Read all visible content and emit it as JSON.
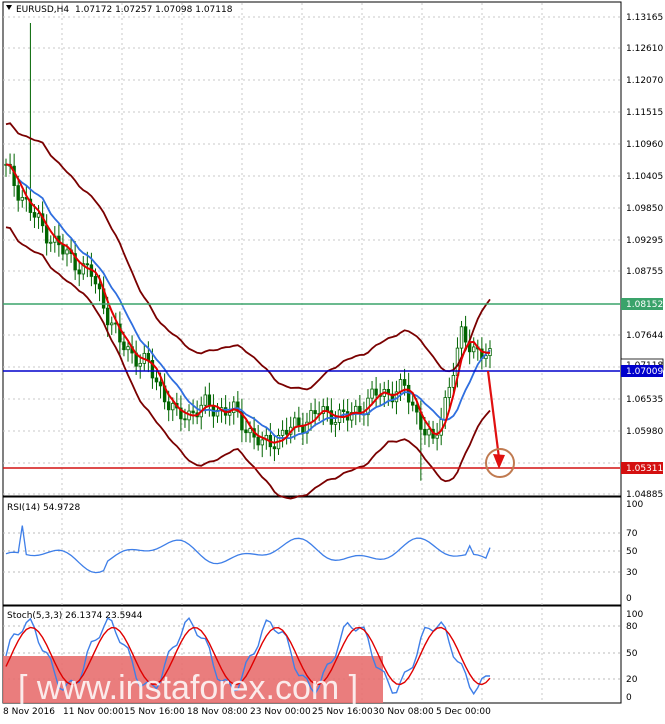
{
  "header": {
    "symbol": "EURUSD,H4",
    "ohlc": "1.07172 1.07257 1.07098 1.07118"
  },
  "colors": {
    "background": "#ffffff",
    "grid": "#c8c8c8",
    "candle": "#006400",
    "bollinger": "#7a0000",
    "ma_fast": "#e00000",
    "ma_slow": "#2f6fe0",
    "resistance_line": "#3aa36a",
    "support_line": "#d41010",
    "pivot_line": "#0000cc",
    "rsi_line": "#3f7fe8",
    "stoch_main": "#3f7fe8",
    "stoch_signal": "#e00000",
    "watermark_bg": "#e86f6f",
    "arrow": "#e01010",
    "target_circle": "#c07a50"
  },
  "price_axis": {
    "ticks": [
      "1.13165",
      "1.12610",
      "1.12070",
      "1.11515",
      "1.10960",
      "1.10405",
      "1.09850",
      "1.09295",
      "1.08755",
      "1.07644",
      "1.06535",
      "1.05980",
      "1.04885"
    ]
  },
  "labels": {
    "resistance": "1.08152",
    "current": "1.07118",
    "pivot": "1.07009",
    "support": "1.05311"
  },
  "rsi": {
    "title": "RSI(14) 54.9728",
    "ticks": [
      "100",
      "70",
      "50",
      "30",
      "0"
    ]
  },
  "stoch": {
    "title": "Stoch(5,3,3) 26.1374 23.5944",
    "ticks": [
      "100",
      "80",
      "50",
      "20",
      "0"
    ]
  },
  "time_axis": {
    "labels": [
      "8 Nov 2016",
      "11 Nov 00:00",
      "15 Nov 16:00",
      "18 Nov 08:00",
      "23 Nov 00:00",
      "25 Nov 16:00",
      "30 Nov 08:00",
      "5 Dec 00:00"
    ]
  },
  "watermark": {
    "text": "[ www.instaforex.com ]"
  },
  "chart_data": [
    {
      "type": "candlestick",
      "title": "EURUSD,H4",
      "ylim": [
        1.0475,
        1.1335
      ],
      "indicators": [
        "Bollinger Bands",
        "Moving Average (fast)",
        "Moving Average (slow)"
      ],
      "levels": {
        "resistance": 1.08152,
        "pivot": 1.07009,
        "support": 1.05311,
        "last_price": 1.07118
      },
      "forecast": "down arrow from ~1.0703 toward 1.05311 support",
      "candles_sampled": [
        {
          "x": "8 Nov 2016",
          "open": 1.104,
          "high": 1.106,
          "low": 1.102,
          "close": 1.1045
        },
        {
          "x": "9 Nov",
          "open": 1.105,
          "high": 1.13,
          "low": 1.1,
          "close": 1.096
        },
        {
          "x": "10 Nov",
          "open": 1.096,
          "high": 1.1,
          "low": 1.088,
          "close": 1.09
        },
        {
          "x": "11 Nov 00:00",
          "open": 1.09,
          "high": 1.093,
          "low": 1.083,
          "close": 1.086
        },
        {
          "x": "14 Nov",
          "open": 1.086,
          "high": 1.087,
          "low": 1.071,
          "close": 1.074
        },
        {
          "x": "15 Nov 16:00",
          "open": 1.074,
          "high": 1.077,
          "low": 1.069,
          "close": 1.07
        },
        {
          "x": "16 Nov",
          "open": 1.07,
          "high": 1.072,
          "low": 1.059,
          "close": 1.061
        },
        {
          "x": "18 Nov 08:00",
          "open": 1.061,
          "high": 1.064,
          "low": 1.058,
          "close": 1.063
        },
        {
          "x": "21 Nov",
          "open": 1.063,
          "high": 1.065,
          "low": 1.06,
          "close": 1.062
        },
        {
          "x": "23 Nov 00:00",
          "open": 1.06,
          "high": 1.062,
          "low": 1.053,
          "close": 1.056
        },
        {
          "x": "24 Nov",
          "open": 1.056,
          "high": 1.061,
          "low": 1.055,
          "close": 1.059
        },
        {
          "x": "25 Nov 16:00",
          "open": 1.059,
          "high": 1.066,
          "low": 1.058,
          "close": 1.062
        },
        {
          "x": "28 Nov",
          "open": 1.062,
          "high": 1.065,
          "low": 1.057,
          "close": 1.061
        },
        {
          "x": "30 Nov 08:00",
          "open": 1.061,
          "high": 1.068,
          "low": 1.06,
          "close": 1.065
        },
        {
          "x": "1 Dec",
          "open": 1.065,
          "high": 1.069,
          "low": 1.062,
          "close": 1.066
        },
        {
          "x": "2 Dec",
          "open": 1.066,
          "high": 1.068,
          "low": 1.052,
          "close": 1.056
        },
        {
          "x": "5 Dec 00:00",
          "open": 1.056,
          "high": 1.078,
          "low": 1.054,
          "close": 1.075
        },
        {
          "x": "6 Dec",
          "open": 1.075,
          "high": 1.077,
          "low": 1.07,
          "close": 1.0712
        }
      ]
    },
    {
      "type": "line",
      "title": "RSI(14) 54.9728",
      "ylim": [
        0,
        100
      ],
      "levels": [
        70,
        50,
        30
      ],
      "last_value": 54.9728
    },
    {
      "type": "line",
      "title": "Stoch(5,3,3) 26.1374 23.5944",
      "ylim": [
        0,
        100
      ],
      "levels": [
        80,
        50,
        20
      ],
      "series": [
        {
          "name": "main",
          "last_value": 26.1374
        },
        {
          "name": "signal",
          "last_value": 23.5944
        }
      ]
    }
  ]
}
